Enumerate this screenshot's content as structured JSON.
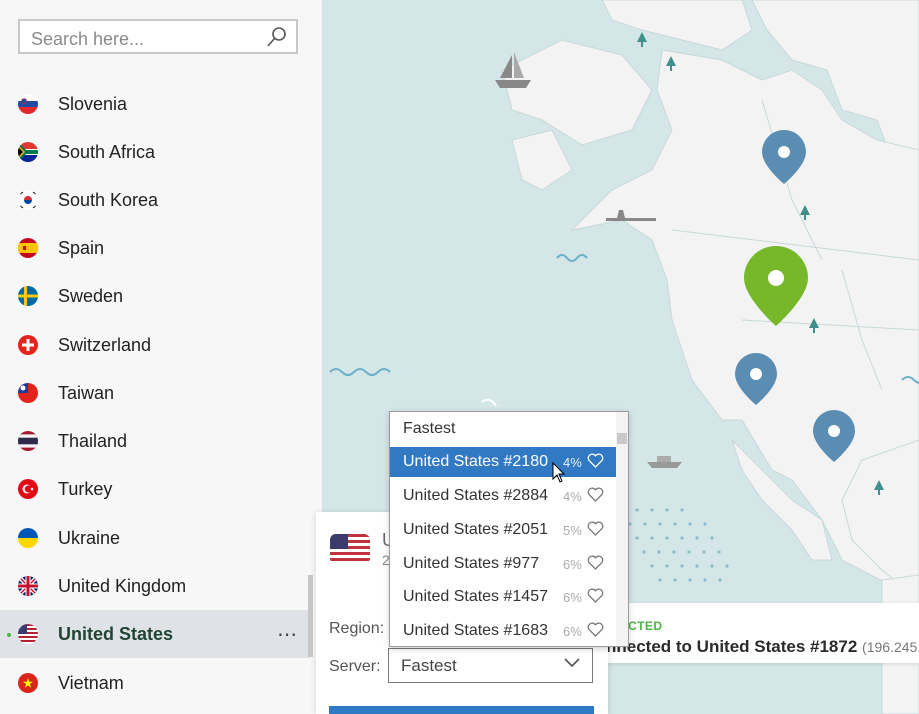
{
  "search": {
    "placeholder": "Search here..."
  },
  "countries": [
    {
      "name": "Slovenia",
      "icon": "slovenia-flag-icon"
    },
    {
      "name": "South Africa",
      "icon": "south-africa-flag-icon"
    },
    {
      "name": "South Korea",
      "icon": "south-korea-flag-icon"
    },
    {
      "name": "Spain",
      "icon": "spain-flag-icon"
    },
    {
      "name": "Sweden",
      "icon": "sweden-flag-icon"
    },
    {
      "name": "Switzerland",
      "icon": "switzerland-flag-icon"
    },
    {
      "name": "Taiwan",
      "icon": "taiwan-flag-icon"
    },
    {
      "name": "Thailand",
      "icon": "thailand-flag-icon"
    },
    {
      "name": "Turkey",
      "icon": "turkey-flag-icon"
    },
    {
      "name": "Ukraine",
      "icon": "ukraine-flag-icon"
    },
    {
      "name": "United Kingdom",
      "icon": "united-kingdom-flag-icon"
    },
    {
      "name": "United States",
      "icon": "united-states-flag-icon",
      "active": true,
      "more": "⋯"
    },
    {
      "name": "Vietnam",
      "icon": "vietnam-flag-icon"
    }
  ],
  "panel": {
    "country_partial": "U",
    "sub_partial": "2",
    "region_label": "Region:",
    "server_label": "Server:",
    "server_value": "Fastest"
  },
  "status": {
    "state": "TECTED",
    "connected_text": "nnected to United States #1872",
    "ip_partial": "(196.245."
  },
  "dropdown": {
    "options": [
      {
        "label": "Fastest",
        "load": "",
        "favorite": false
      },
      {
        "label": "United States #2180",
        "load": "4%",
        "favorite": true,
        "selected": true
      },
      {
        "label": "United States #2884",
        "load": "4%",
        "favorite": true
      },
      {
        "label": "United States #2051",
        "load": "5%",
        "favorite": true
      },
      {
        "label": "United States #977",
        "load": "6%",
        "favorite": true
      },
      {
        "label": "United States #1457",
        "load": "6%",
        "favorite": true
      },
      {
        "label": "United States #1683",
        "load": "6%",
        "favorite": true
      }
    ]
  },
  "colors": {
    "accent": "#3279c4",
    "connected": "#4bb543",
    "pin": "#5b8db3",
    "pin_active": "#76b82a",
    "land": "#f3f3f3",
    "sea": "#d4e6e8"
  }
}
